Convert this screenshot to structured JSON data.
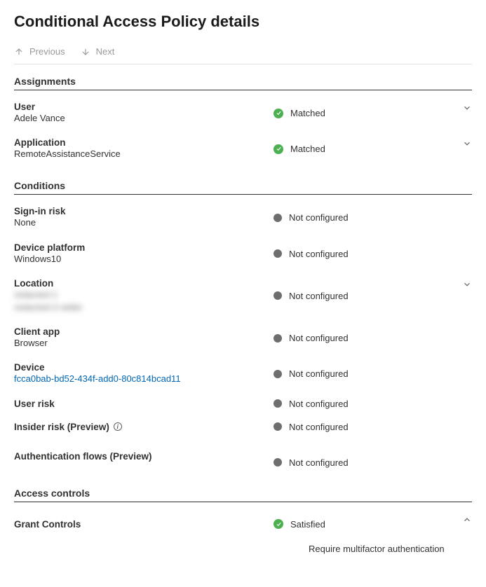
{
  "title": "Conditional Access Policy details",
  "nav": {
    "previous": "Previous",
    "next": "Next"
  },
  "sections": {
    "assignments": "Assignments",
    "conditions": "Conditions",
    "access_controls": "Access controls"
  },
  "status": {
    "matched": "Matched",
    "not_configured": "Not configured",
    "satisfied": "Satisfied"
  },
  "assignments": {
    "user": {
      "label": "User",
      "value": "Adele Vance"
    },
    "application": {
      "label": "Application",
      "value": "RemoteAssistanceService"
    }
  },
  "conditions": {
    "sign_in_risk": {
      "label": "Sign-in risk",
      "value": "None"
    },
    "device_platform": {
      "label": "Device platform",
      "value": "Windows10"
    },
    "location": {
      "label": "Location",
      "value_line1": "redacted-1",
      "value_line2": "redacted-2-wider"
    },
    "client_app": {
      "label": "Client app",
      "value": "Browser"
    },
    "device": {
      "label": "Device",
      "value": "fcca0bab-bd52-434f-add0-80c814bcad11"
    },
    "user_risk": {
      "label": "User risk"
    },
    "insider_risk": {
      "label": "Insider risk (Preview)"
    },
    "auth_flows": {
      "label": "Authentication flows (Preview)"
    }
  },
  "access_controls": {
    "grant": {
      "label": "Grant Controls",
      "detail": "Require multifactor authentication"
    }
  }
}
